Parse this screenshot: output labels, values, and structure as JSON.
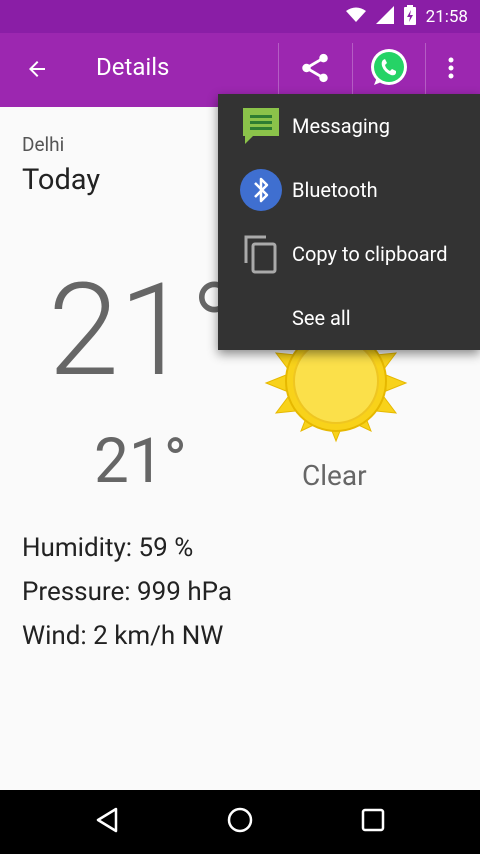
{
  "status_bar": {
    "time": "21:58"
  },
  "app_bar": {
    "title": "Details"
  },
  "weather": {
    "city": "Delhi",
    "day": "Today",
    "temp_high": "21°",
    "temp_low": "21°",
    "condition": "Clear",
    "humidity": "Humidity: 59 %",
    "pressure": "Pressure: 999 hPa",
    "wind": "Wind: 2 km/h NW"
  },
  "share_menu": {
    "items": [
      {
        "label": "Messaging",
        "icon": "messaging-icon"
      },
      {
        "label": "Bluetooth",
        "icon": "bluetooth-icon"
      },
      {
        "label": "Copy to clipboard",
        "icon": "copy-icon"
      },
      {
        "label": "See all"
      }
    ]
  },
  "colors": {
    "status_bar": "#8a1ea6",
    "app_bar": "#9c27b0",
    "menu_bg": "#333333",
    "whatsapp": "#25d366"
  }
}
